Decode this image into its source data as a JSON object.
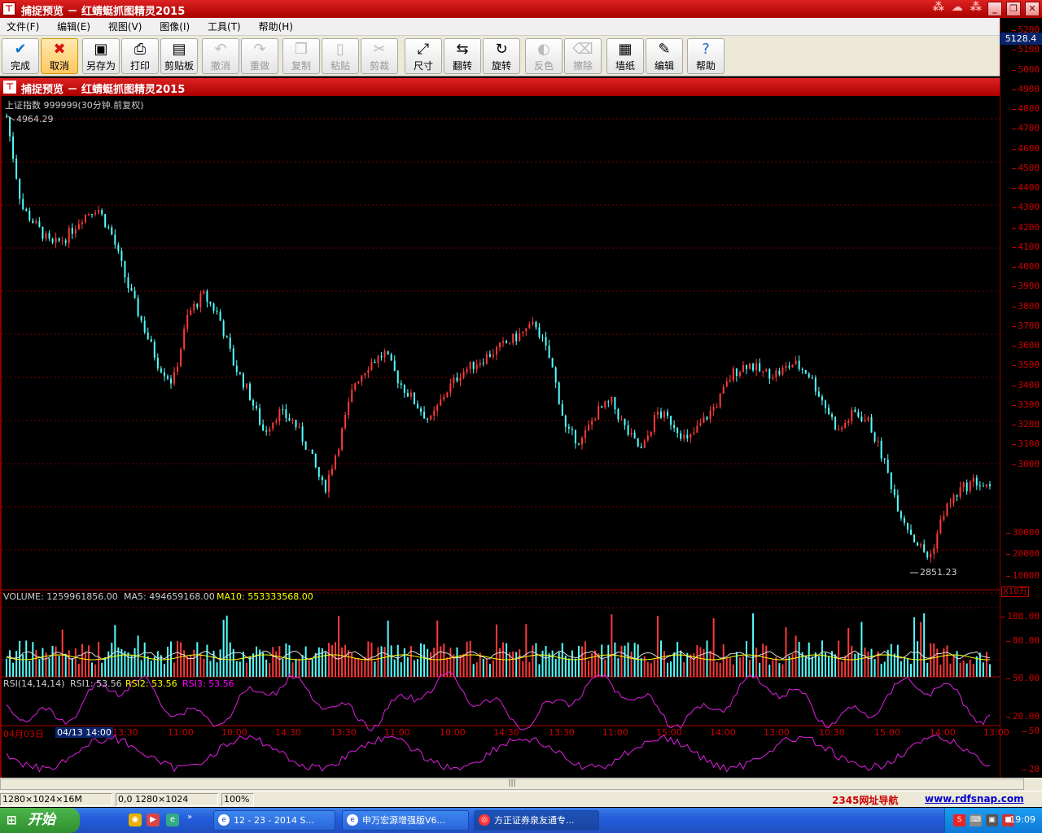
{
  "window": {
    "title": "捕捉预览 － 红蜻蜓抓图精灵2015",
    "inner_title": "捕捉预览 － 红蜻蜓抓图精灵2015"
  },
  "menu": [
    "文件(F)",
    "编辑(E)",
    "视图(V)",
    "图像(I)",
    "工具(T)",
    "帮助(H)"
  ],
  "toolbar": [
    {
      "label": "完成",
      "icon": "check-icon",
      "glyph": "✔",
      "enabled": true
    },
    {
      "label": "取消",
      "icon": "cancel-icon",
      "glyph": "✖",
      "enabled": true,
      "selected": true
    },
    {
      "label": "另存为",
      "icon": "save-as-icon",
      "glyph": "▣",
      "enabled": true
    },
    {
      "label": "打印",
      "icon": "print-icon",
      "glyph": "⎙",
      "enabled": true
    },
    {
      "label": "剪贴板",
      "icon": "clipboard-icon",
      "glyph": "▤",
      "enabled": true
    },
    {
      "label": "撤消",
      "icon": "undo-icon",
      "glyph": "↶",
      "enabled": false
    },
    {
      "label": "重做",
      "icon": "redo-icon",
      "glyph": "↷",
      "enabled": false
    },
    {
      "label": "复制",
      "icon": "copy-icon",
      "glyph": "❐",
      "enabled": false
    },
    {
      "label": "粘贴",
      "icon": "paste-icon",
      "glyph": "▯",
      "enabled": false
    },
    {
      "label": "剪裁",
      "icon": "crop-icon",
      "glyph": "✂",
      "enabled": false
    },
    {
      "label": "尺寸",
      "icon": "resize-icon",
      "glyph": "⤢",
      "enabled": true
    },
    {
      "label": "翻转",
      "icon": "flip-icon",
      "glyph": "⇆",
      "enabled": true
    },
    {
      "label": "旋转",
      "icon": "rotate-icon",
      "glyph": "↻",
      "enabled": true
    },
    {
      "label": "反色",
      "icon": "invert-icon",
      "glyph": "◐",
      "enabled": false
    },
    {
      "label": "擦除",
      "icon": "eraser-icon",
      "glyph": "⌫",
      "enabled": false
    },
    {
      "label": "墙纸",
      "icon": "wallpaper-icon",
      "glyph": "▦",
      "enabled": true
    },
    {
      "label": "编辑",
      "icon": "edit-icon",
      "glyph": "✎",
      "enabled": true
    },
    {
      "label": "帮助",
      "icon": "help-icon",
      "glyph": "?",
      "enabled": true
    }
  ],
  "axis": {
    "current_value": "5128.4",
    "price_ticks": [
      "5200",
      "5100",
      "5000",
      "4900",
      "4800",
      "4700",
      "4600",
      "4500",
      "4400",
      "4300",
      "4200",
      "4100",
      "4000",
      "3900",
      "3800",
      "3700",
      "3600",
      "3500",
      "3400",
      "3300",
      "3200",
      "3100",
      "3000"
    ],
    "volume_ticks": [
      "30000",
      "20000",
      "10000"
    ],
    "unit": "X10万",
    "rsi_ticks": [
      "100.00",
      "80.00",
      "50.00",
      "20.00"
    ],
    "rsi_low_ticks": [
      "50",
      "20"
    ]
  },
  "chart": {
    "symbol_label": "上证指数 999999(30分钟.前复权)",
    "high_label": "4964.29",
    "low_label": "2851.23",
    "volume_label": "VOLUME: 1259961856.00",
    "ma5_label": "MA5: 494659168.00",
    "ma10_label": "MA10: 553333568.00",
    "rsi_label": "RSI(14,14,14)",
    "rsi1_label": "RSI1: 53.56",
    "rsi2_label": "RSI2: 53.56",
    "rsi3_label": "RSI3: 53.56",
    "time_axis": [
      "04月03日",
      "04/13 14:00",
      "13:30",
      "11:00",
      "10:00",
      "14:30",
      "13:30",
      "11:00",
      "10:00",
      "14:30",
      "13:30",
      "11:00",
      "15:00",
      "14:00",
      "13:00",
      "10:30",
      "15:00",
      "14:00",
      "13:00"
    ],
    "up_color": "#ff3a3a",
    "down_color": "#54ffff"
  },
  "chart_data": {
    "type": "candlestick",
    "title": "上证指数 999999(30分钟.前复权)",
    "ylim": [
      2800,
      5200
    ],
    "high": 4964.29,
    "low": 2851.23,
    "close_series": [
      4960,
      4500,
      4400,
      4300,
      4350,
      4450,
      4500,
      4350,
      4100,
      3900,
      3700,
      3600,
      3950,
      4050,
      3950,
      3700,
      3550,
      3350,
      3450,
      3400,
      3250,
      3050,
      3300,
      3600,
      3700,
      3750,
      3600,
      3500,
      3400,
      3550,
      3650,
      3700,
      3750,
      3800,
      3850,
      3900,
      3700,
      3350,
      3300,
      3450,
      3500,
      3350,
      3250,
      3450,
      3400,
      3300,
      3400,
      3500,
      3650,
      3700,
      3650,
      3650,
      3700,
      3650,
      3500,
      3350,
      3450,
      3400,
      3200,
      2950,
      2800,
      2700,
      2950,
      3050,
      3100,
      3050
    ]
  },
  "status": {
    "dims": "1280×1024×16M",
    "pos": "0,0  1280×1024",
    "zoom": "100%",
    "nav_link": "2345网址导航",
    "site_link": "www.rdfsnap.com"
  },
  "taskbar": {
    "start_label": "开始",
    "tasks": [
      "12 - 23 - 2014 S...",
      "申万宏源增强版V6...",
      "方正证券泉友通专..."
    ],
    "clock": "19:09"
  }
}
